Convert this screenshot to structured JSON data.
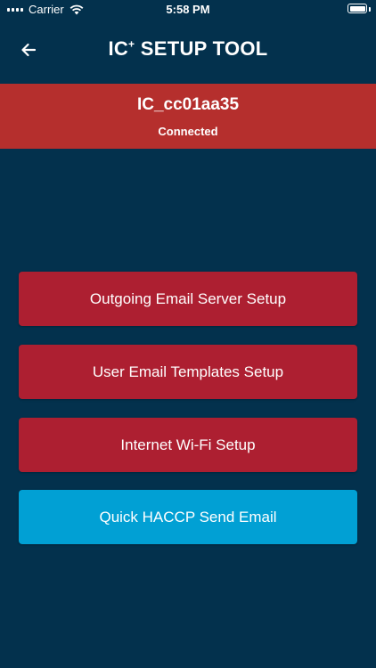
{
  "status_bar": {
    "carrier": "Carrier",
    "time": "5:58 PM"
  },
  "nav": {
    "title_main": "IC",
    "title_sup": "+",
    "title_rest": " SETUP TOOL"
  },
  "device": {
    "name": "IC_cc01aa35",
    "status": "Connected"
  },
  "menu": {
    "outgoing_email": "Outgoing Email Server Setup",
    "email_templates": "User Email Templates Setup",
    "wifi_setup": "Internet Wi-Fi Setup",
    "quick_haccp": "Quick HACCP Send Email"
  },
  "colors": {
    "background": "#03314d",
    "banner": "#b52f2d",
    "button_red": "#ad1f31",
    "button_blue": "#01a0d4"
  },
  "icons": {
    "back": "arrow-left-icon",
    "wifi": "wifi-icon",
    "signal": "signal-icon",
    "battery": "battery-icon"
  }
}
